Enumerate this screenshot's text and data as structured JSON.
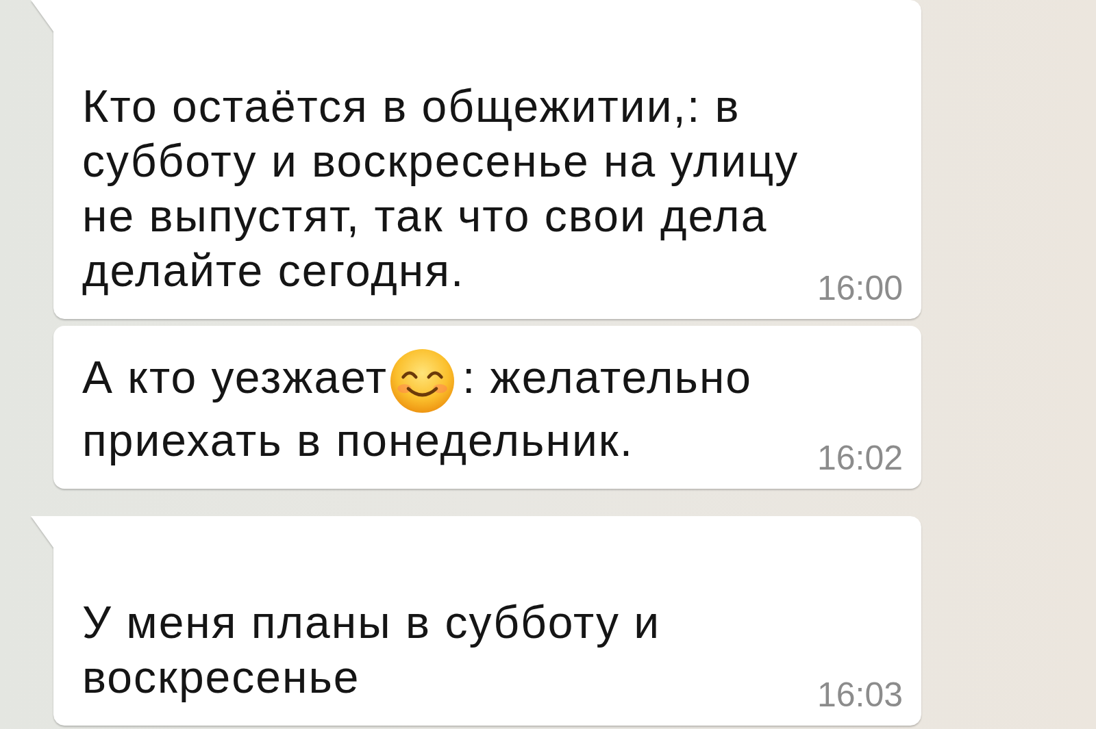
{
  "chat": {
    "messages": [
      {
        "kind": "incoming",
        "tail": true,
        "segments": [
          {
            "kind": "text",
            "text": "Кто остаётся в общежитии,: в субботу и воскресенье на улицу не выпустят, так что свои дела делайте сегодня."
          }
        ],
        "time": "16:00"
      },
      {
        "kind": "incoming",
        "tail": false,
        "segments": [
          {
            "kind": "text",
            "text": "А кто уезжает"
          },
          {
            "kind": "emoji"
          },
          {
            "kind": "text",
            "text": ": желательно приехать в понедельник."
          }
        ],
        "time": "16:02"
      },
      {
        "kind": "incoming",
        "tail": true,
        "segments": [
          {
            "kind": "text",
            "text": "У меня планы в субботу и воскресенье"
          }
        ],
        "time": "16:03"
      }
    ]
  }
}
